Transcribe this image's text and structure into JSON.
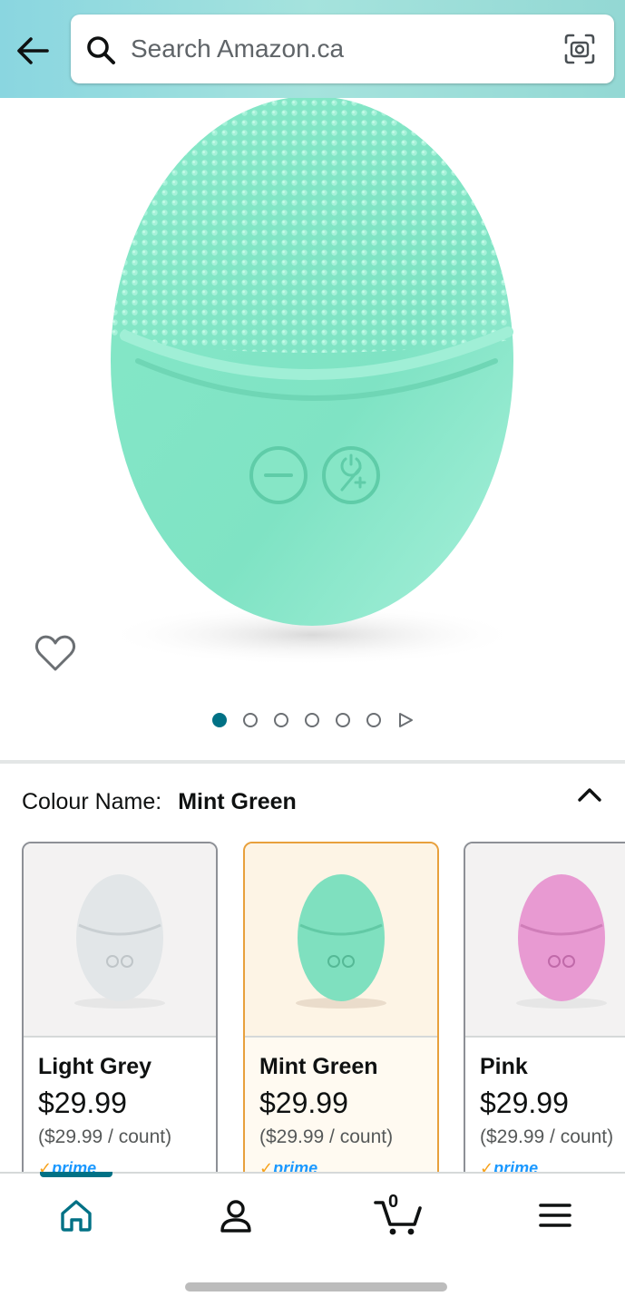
{
  "header": {
    "search_placeholder": "Search Amazon.ca"
  },
  "gallery": {
    "total_images": 6,
    "active_index": 0
  },
  "colour": {
    "label": "Colour Name:",
    "selected": "Mint Green"
  },
  "variants": [
    {
      "name": "Light Grey",
      "price": "$29.99",
      "unit_price": "($29.99 / count)",
      "badge": "prime",
      "selected": false,
      "color": "#dfe4e6"
    },
    {
      "name": "Mint Green",
      "price": "$29.99",
      "unit_price": "($29.99 / count)",
      "badge": "prime",
      "selected": true,
      "color": "#7fe0bf"
    },
    {
      "name": "Pink",
      "price": "$29.99",
      "unit_price": "($29.99 / count)",
      "badge": "prime",
      "selected": false,
      "color": "#e89ad2"
    }
  ],
  "nav": {
    "cart_count": "0",
    "items": [
      "home-icon",
      "account-icon",
      "cart-icon",
      "menu-icon"
    ]
  },
  "colors": {
    "accent": "#007185",
    "selected_border": "#e8a03c",
    "product": "#7ee3c4"
  }
}
